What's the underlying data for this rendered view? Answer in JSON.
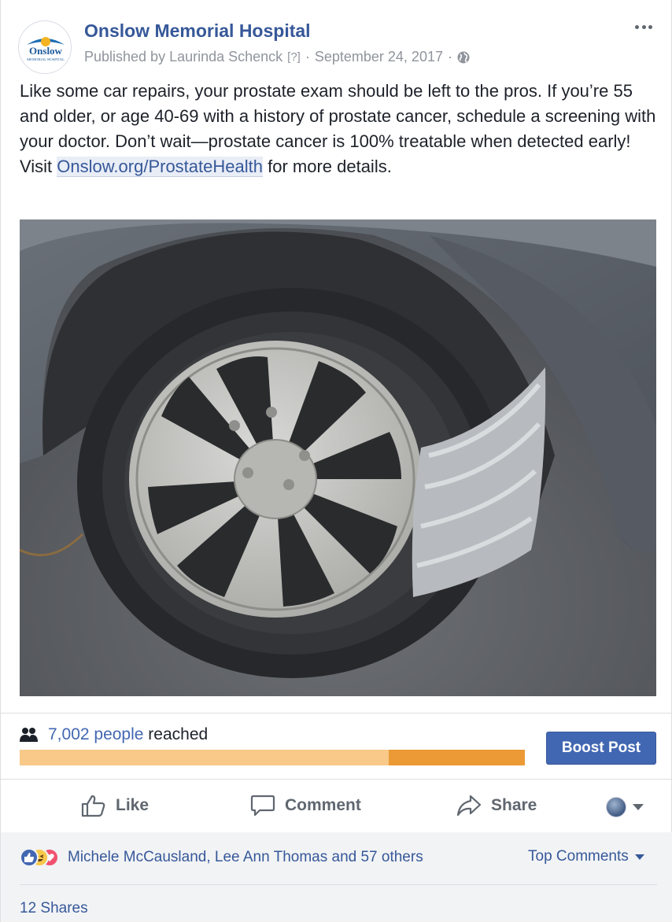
{
  "header": {
    "page_name": "Onslow Memorial Hospital",
    "avatar_logo_text": "Onslow",
    "avatar_logo_subtext": "MEMORIAL HOSPITAL",
    "published_by": "Published by Laurinda Schenck",
    "help_marker": "[?]",
    "separator": "·",
    "date": "September 24, 2017",
    "privacy_icon": "globe-icon"
  },
  "post": {
    "text_before_link": "Like some car repairs, your prostate exam should be left to the pros. If you’re 55 and older, or age 40-69 with a history of prostate cancer, schedule a screening with your doctor. Don’t wait—prostate cancer is 100% treatable when detected early! Visit ",
    "link_text": "Onslow.org/ProstateHealth",
    "text_after_link": " for more details."
  },
  "reach": {
    "icon": "people-icon",
    "count": "7,002 people",
    "suffix": "reached",
    "organic_fraction": 0.73,
    "colors": {
      "organic": "#f8c989",
      "paid": "#eb9a35"
    }
  },
  "boost": {
    "label": "Boost Post",
    "color": "#4267b2"
  },
  "actions": {
    "like": "Like",
    "comment": "Comment",
    "share": "Share"
  },
  "reactions": {
    "types": [
      "like",
      "haha",
      "love"
    ],
    "summary": "Michele McCausland, Lee Ann Thomas and 57 others",
    "top_comments": "Top Comments"
  },
  "shares": {
    "label": "12 Shares"
  }
}
